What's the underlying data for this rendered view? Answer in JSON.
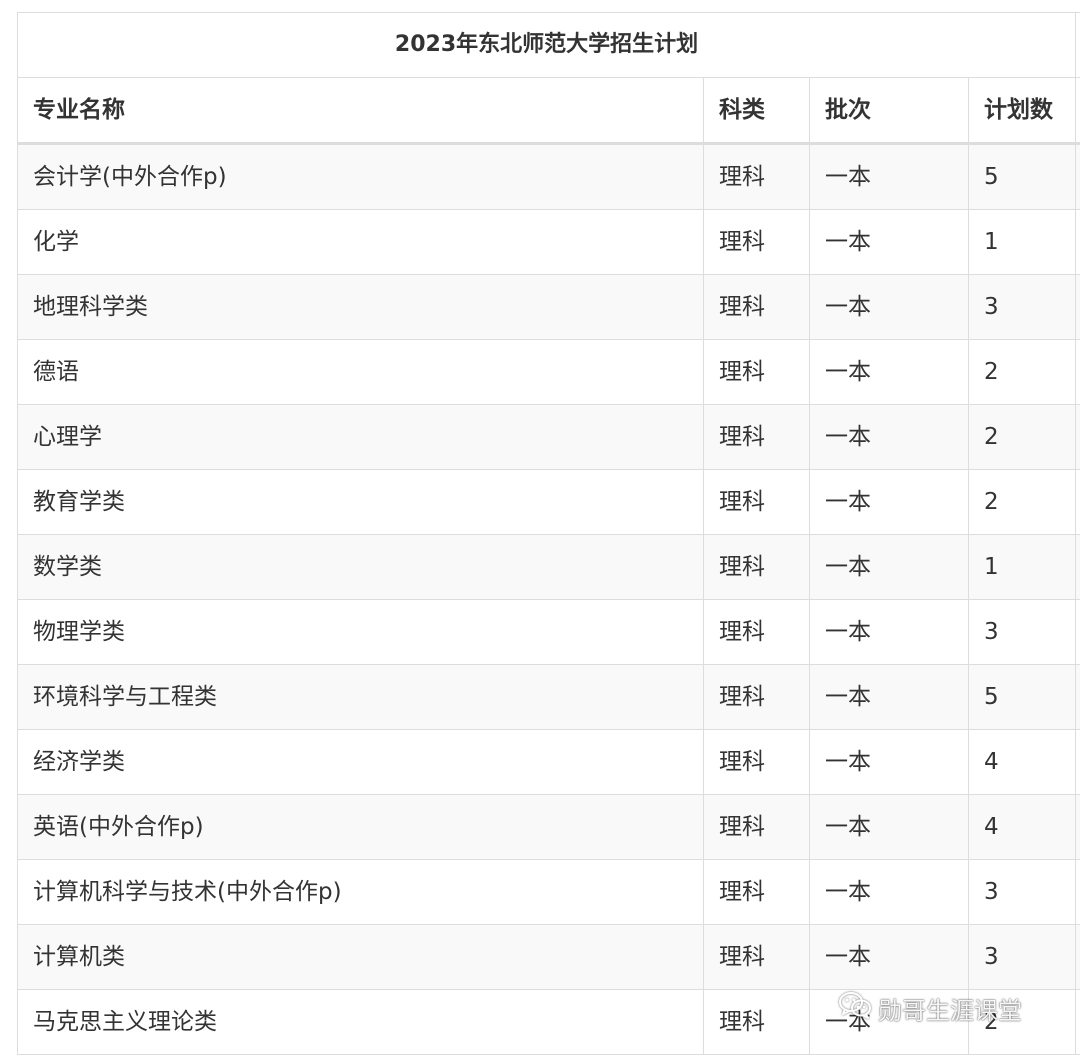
{
  "table": {
    "title": "2023年东北师范大学招生计划",
    "headers": [
      "专业名称",
      "科类",
      "批次",
      "计划数"
    ],
    "rows": [
      {
        "name": "会计学(中外合作p)",
        "type": "理科",
        "batch": "一本",
        "count": "5"
      },
      {
        "name": "化学",
        "type": "理科",
        "batch": "一本",
        "count": "1"
      },
      {
        "name": "地理科学类",
        "type": "理科",
        "batch": "一本",
        "count": "3"
      },
      {
        "name": "德语",
        "type": "理科",
        "batch": "一本",
        "count": "2"
      },
      {
        "name": "心理学",
        "type": "理科",
        "batch": "一本",
        "count": "2"
      },
      {
        "name": "教育学类",
        "type": "理科",
        "batch": "一本",
        "count": "2"
      },
      {
        "name": "数学类",
        "type": "理科",
        "batch": "一本",
        "count": "1"
      },
      {
        "name": "物理学类",
        "type": "理科",
        "batch": "一本",
        "count": "3"
      },
      {
        "name": "环境科学与工程类",
        "type": "理科",
        "batch": "一本",
        "count": "5"
      },
      {
        "name": "经济学类",
        "type": "理科",
        "batch": "一本",
        "count": "4"
      },
      {
        "name": "英语(中外合作p)",
        "type": "理科",
        "batch": "一本",
        "count": "4"
      },
      {
        "name": "计算机科学与技术(中外合作p)",
        "type": "理科",
        "batch": "一本",
        "count": "3"
      },
      {
        "name": "计算机类",
        "type": "理科",
        "batch": "一本",
        "count": "3"
      },
      {
        "name": "马克思主义理论类",
        "type": "理科",
        "batch": "一本",
        "count": "2"
      }
    ]
  },
  "watermark": {
    "icon": "wechat-icon",
    "text": "勋哥生涯课堂"
  }
}
